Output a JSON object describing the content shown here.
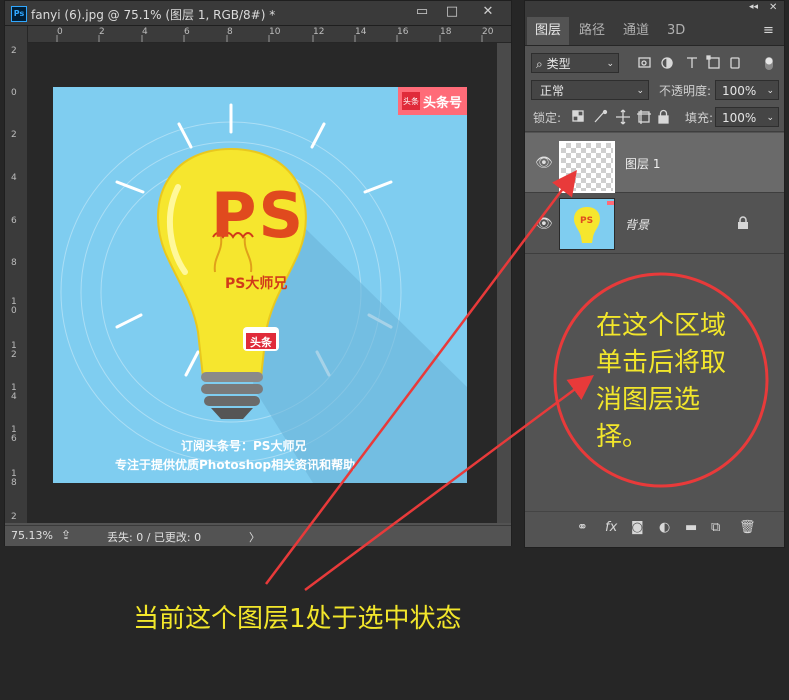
{
  "document": {
    "title": "fanyi (6).jpg @ 75.1% (图层 1, RGB/8#) *",
    "ps_logo": "Ps",
    "window_buttons": [
      "▭",
      "□",
      "✕"
    ],
    "ruler_top": [
      "0",
      "2",
      "4",
      "6",
      "8",
      "10",
      "12",
      "14",
      "16",
      "18",
      "20"
    ],
    "ruler_left": [
      "2",
      "0",
      "2",
      "4",
      "6",
      "8",
      "10",
      "12",
      "14",
      "16",
      "18",
      "2"
    ],
    "zoom": "75.13%",
    "status_text": "丢失: 0 / 已更改: 0",
    "status_arrow": "〉"
  },
  "artwork": {
    "badge": "头条号",
    "badge_icon": "头条",
    "bulb_ps": "PS",
    "bulb_sub": "PS大师兄",
    "bulb_tag": "头条",
    "line1": "订阅头条号：PS大师兄",
    "line2": "专注于提供优质Photoshop相关资讯和帮助",
    "bg_color": "#7fcdf0",
    "bulb_color": "#f6e62e",
    "ps_color": "#e04a1e"
  },
  "panel": {
    "collapse_icon": "◂◂",
    "close_icon": "✕",
    "tabs": [
      "图层",
      "路径",
      "通道",
      "3D"
    ],
    "menu_icon": "≡",
    "filter": {
      "label": "类型",
      "search_glyph": "⌕"
    },
    "blend_mode": "正常",
    "opacity_label": "不透明度:",
    "opacity_value": "100%",
    "lock_label": "锁定:",
    "fill_label": "填充:",
    "fill_value": "100%",
    "layers": [
      {
        "name": "图层 1",
        "selected": true,
        "visible": true
      },
      {
        "name": "背景",
        "selected": false,
        "visible": true,
        "locked": true
      }
    ],
    "footer_icons": [
      "link-icon",
      "fx-icon",
      "mask-icon",
      "adjustment-icon",
      "folder-icon",
      "new-layer-icon",
      "trash-icon"
    ],
    "fx_label": "fx"
  },
  "annotations": {
    "bottom": "当前这个图层1处于选中状态",
    "circle": "在这个区域单击后将取消图层选择。",
    "arrow_color": "#e83a3a",
    "text_color": "#f2e62b"
  }
}
